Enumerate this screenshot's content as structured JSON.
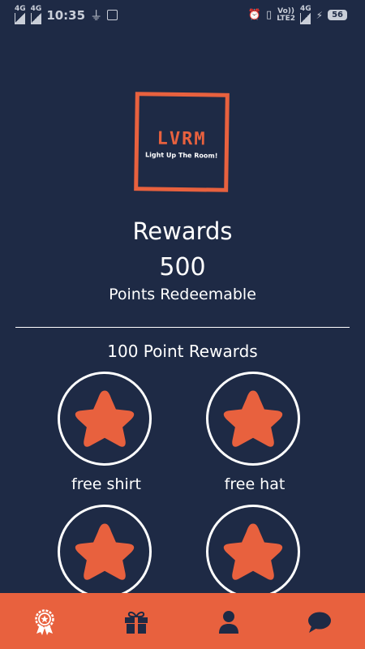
{
  "status_bar": {
    "signal_1": "4G",
    "signal_2": "4G",
    "time": "10:35",
    "volte": "Vo))",
    "lte": "LTE2",
    "signal_3": "4G",
    "battery": "56"
  },
  "logo": {
    "title": "LVRM",
    "tagline": "Light Up The Room!"
  },
  "header": {
    "title": "Rewards",
    "points": "500",
    "points_label": "Points Redeemable"
  },
  "section": {
    "title": "100 Point Rewards"
  },
  "rewards": [
    {
      "label": "free shirt"
    },
    {
      "label": "free hat"
    },
    {
      "label": ""
    },
    {
      "label": ""
    }
  ],
  "tab_bar": {
    "items": [
      {
        "icon": "award-icon",
        "active": true
      },
      {
        "icon": "gift-icon",
        "active": false
      },
      {
        "icon": "user-icon",
        "active": false
      },
      {
        "icon": "chat-icon",
        "active": false
      }
    ]
  },
  "colors": {
    "background": "#1e2a45",
    "accent": "#e8613e",
    "text": "#ffffff"
  }
}
